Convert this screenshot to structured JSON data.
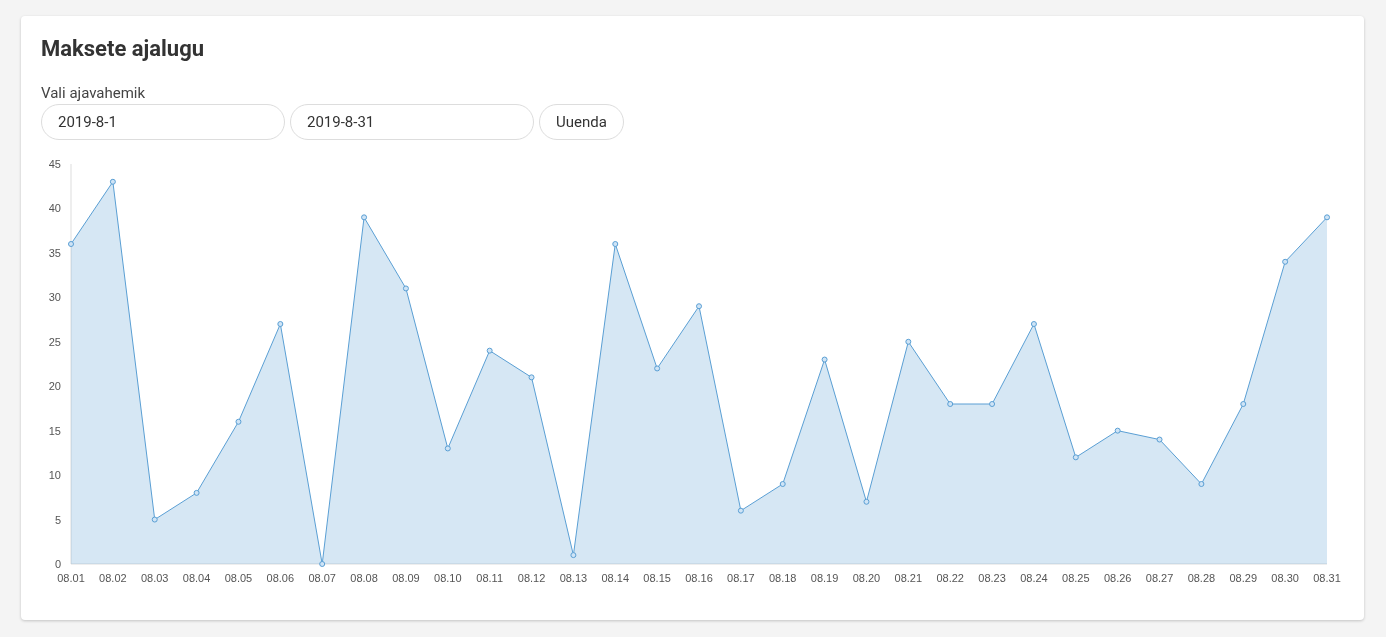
{
  "title": "Maksete ajalugu",
  "range": {
    "label": "Vali ajavahemik",
    "start": "2019-8-1",
    "end": "2019-8-31",
    "button": "Uuenda"
  },
  "chart_data": {
    "type": "area",
    "categories": [
      "08.01",
      "08.02",
      "08.03",
      "08.04",
      "08.05",
      "08.06",
      "08.07",
      "08.08",
      "08.09",
      "08.10",
      "08.11",
      "08.12",
      "08.13",
      "08.14",
      "08.15",
      "08.16",
      "08.17",
      "08.18",
      "08.19",
      "08.20",
      "08.21",
      "08.22",
      "08.23",
      "08.24",
      "08.25",
      "08.26",
      "08.27",
      "08.28",
      "08.29",
      "08.30",
      "08.31"
    ],
    "series": [
      {
        "color": "#5a9fd4",
        "values": [
          36,
          43,
          5,
          8,
          16,
          27,
          0,
          39,
          31,
          13,
          24,
          21,
          1,
          36,
          22,
          29,
          6,
          9,
          23,
          7,
          25,
          18,
          18,
          27,
          12,
          15,
          14,
          9,
          18,
          34,
          39
        ]
      }
    ],
    "ylim": [
      0,
      45
    ],
    "yticks": [
      0,
      5,
      10,
      15,
      20,
      25,
      30,
      35,
      40,
      45
    ]
  }
}
